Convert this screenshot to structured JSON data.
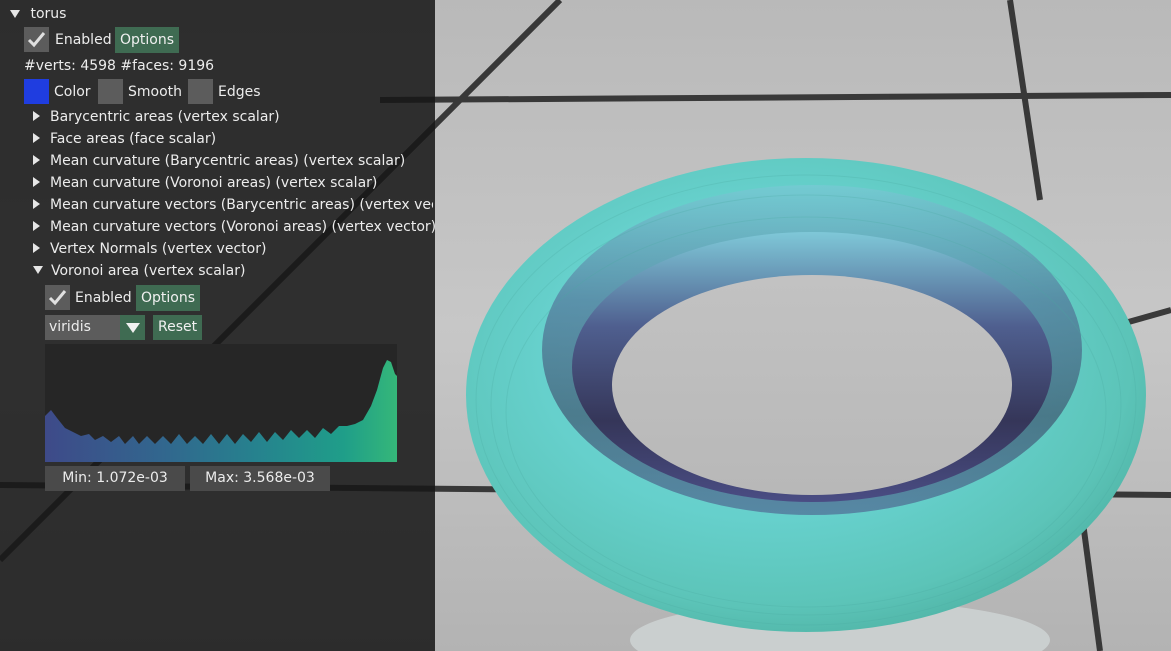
{
  "structure": {
    "name": "torus",
    "enabled_label": "Enabled",
    "options_label": "Options",
    "stats": "#verts: 4598  #faces: 9196",
    "color_label": "Color",
    "smooth_label": "Smooth",
    "edges_label": "Edges",
    "color_swatch": "#1f3de0"
  },
  "quantities": [
    "Barycentric areas (vertex scalar)",
    "Face areas (face scalar)",
    "Mean curvature (Barycentric areas) (vertex scalar)",
    "Mean curvature (Voronoi areas) (vertex scalar)",
    "Mean curvature vectors (Barycentric areas) (vertex vector)",
    "Mean curvature vectors (Voronoi areas) (vertex vector)",
    "Vertex Normals (vertex vector)"
  ],
  "voronoi": {
    "label": "Voronoi area (vertex scalar)",
    "enabled_label": "Enabled",
    "options_label": "Options",
    "colormap": "viridis",
    "reset_label": "Reset",
    "min_label": "Min: 1.072e-03",
    "max_label": "Max: 3.568e-03"
  },
  "colors": {
    "accent": "#3f6b52",
    "panel_bg": "#161616",
    "torus_outer": "#5cc7c0",
    "torus_inner": "#3b3f6e"
  }
}
